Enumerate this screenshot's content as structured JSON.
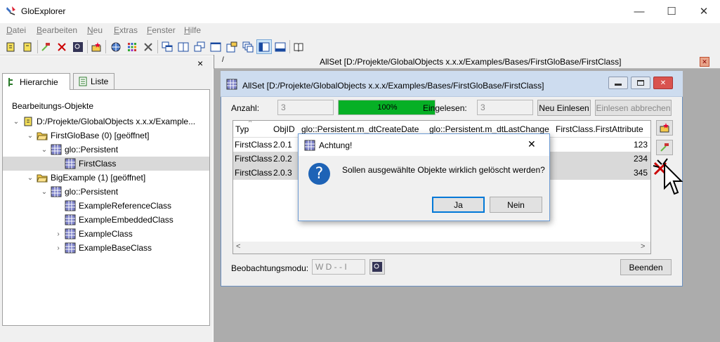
{
  "app": {
    "title": "GloExplorer",
    "controls": {
      "minimize": "—",
      "maximize": "☐",
      "close": "✕"
    }
  },
  "menu": [
    {
      "label": "Datei"
    },
    {
      "label": "Bearbeiten"
    },
    {
      "label": "Neu"
    },
    {
      "label": "Extras"
    },
    {
      "label": "Fenster"
    },
    {
      "label": "Hilfe"
    }
  ],
  "left_panel": {
    "close": "×",
    "tabs": [
      {
        "label": "Hierarchie"
      },
      {
        "label": "Liste"
      }
    ],
    "tree_header": "Bearbeitungs-Objekte",
    "tree": [
      {
        "label": "D:/Projekte/GlobalObjects x.x.x/Example...",
        "indent": 0,
        "chev": "v",
        "icon": "db"
      },
      {
        "label": "FirstGloBase (0) [geöffnet]",
        "indent": 1,
        "chev": "v",
        "icon": "folder"
      },
      {
        "label": "glo::Persistent",
        "indent": 2,
        "chev": "v",
        "icon": "class"
      },
      {
        "label": "FirstClass",
        "indent": 3,
        "chev": "",
        "icon": "class",
        "selected": true
      },
      {
        "label": "BigExample (1) [geöffnet]",
        "indent": 1,
        "chev": "v",
        "icon": "folder"
      },
      {
        "label": "glo::Persistent",
        "indent": 2,
        "chev": "v",
        "icon": "class"
      },
      {
        "label": "ExampleReferenceClass",
        "indent": 3,
        "chev": "",
        "icon": "class"
      },
      {
        "label": "ExampleEmbeddedClass",
        "indent": 3,
        "chev": "",
        "icon": "class"
      },
      {
        "label": "ExampleClass",
        "indent": 3,
        "chev": ">",
        "icon": "class"
      },
      {
        "label": "ExampleBaseClass",
        "indent": 3,
        "chev": ">",
        "icon": "class"
      }
    ]
  },
  "doc_tab": {
    "title": "AllSet [D:/Projekte/GlobalObjects x.x.x/Examples/Bases/FirstGloBase/FirstClass]",
    "close": "✕"
  },
  "inner_window": {
    "title": "AllSet [D:/Projekte/GlobalObjects x.x.x/Examples/Bases/FirstGloBase/FirstClass]",
    "anzahl_label": "Anzahl:",
    "anzahl_value": "3",
    "progress": {
      "value": 100,
      "label": "100%"
    },
    "eingelesen_label": "Eingelesen:",
    "eingelesen_value": "3",
    "neu_einlesen": "Neu Einlesen",
    "einlesen_abbrechen": "Einlesen abbrechen",
    "columns": [
      "Typ",
      "ObjID",
      "glo::Persistent.m_dtCreateDate",
      "glo::Persistent.m_dtLastChange",
      "FirstClass.FirstAttribute"
    ],
    "rows": [
      {
        "typ": "FirstClass",
        "objid": "2.0.1",
        "attr": "123"
      },
      {
        "typ": "FirstClass",
        "objid": "2.0.2",
        "attr": "234"
      },
      {
        "typ": "FirstClass",
        "objid": "2.0.3",
        "attr": "345"
      }
    ],
    "beobachtung_label": "Beobachtungsmodu:",
    "beobachtung_value": "W D - - I",
    "beenden": "Beenden"
  },
  "dialog": {
    "title": "Achtung!",
    "message": "Sollen ausgewählte Objekte wirklich gelöscht werden?",
    "yes": "Ja",
    "no": "Nein",
    "close": "✕",
    "icon": "?"
  },
  "colors": {
    "progress": "#06b025",
    "accent": "#0078d7",
    "selection": "#d9d9d9"
  }
}
